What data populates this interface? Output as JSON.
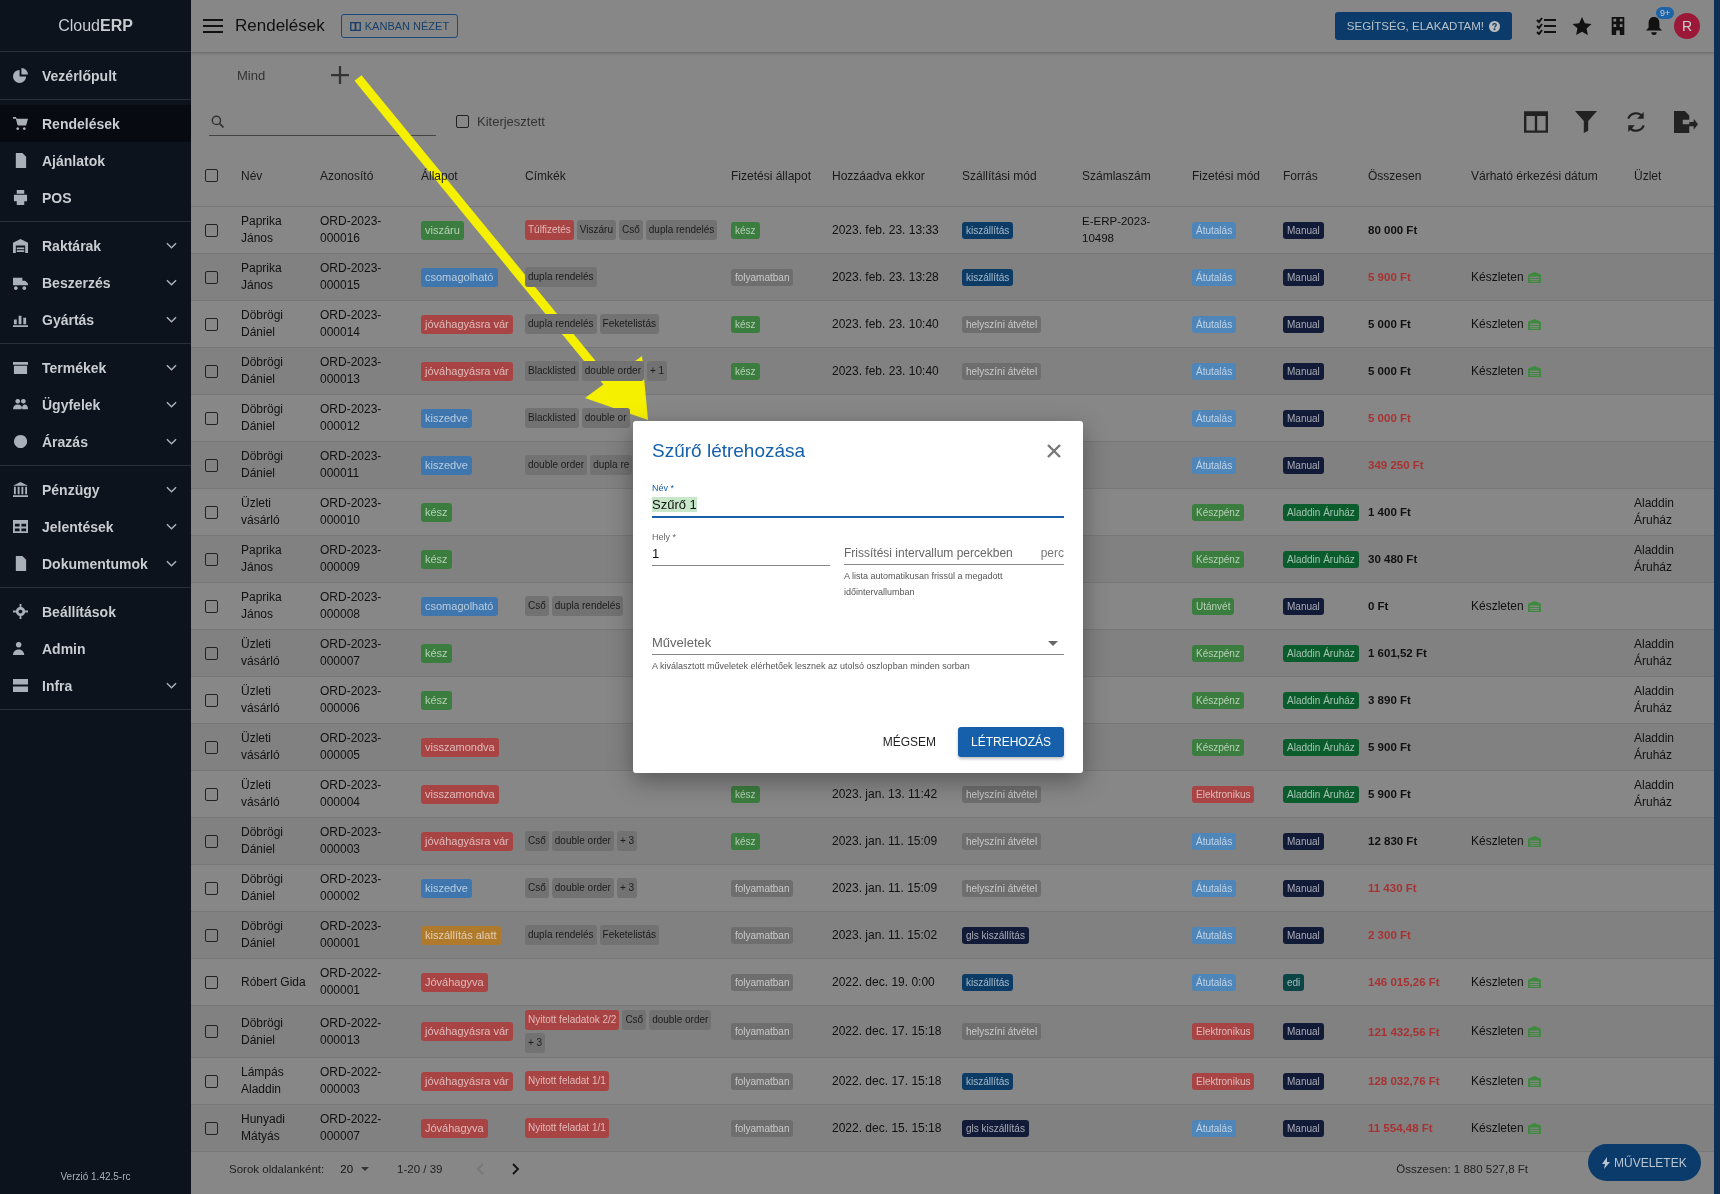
{
  "sidebar": {
    "logo_light": "Cloud",
    "logo_bold": "ERP",
    "groups": [
      {
        "items": [
          {
            "label": "Vezérlőpult",
            "kind": "link",
            "selected": false
          }
        ]
      },
      {
        "items": [
          {
            "label": "Rendelések",
            "kind": "link",
            "selected": true
          },
          {
            "label": "Ajánlatok",
            "kind": "link",
            "selected": false
          },
          {
            "label": "POS",
            "kind": "link",
            "selected": false
          }
        ]
      },
      {
        "items": [
          {
            "label": "Raktárak",
            "kind": "group",
            "selected": false
          },
          {
            "label": "Beszerzés",
            "kind": "group",
            "selected": false
          },
          {
            "label": "Gyártás",
            "kind": "group",
            "selected": false
          }
        ]
      },
      {
        "items": [
          {
            "label": "Termékek",
            "kind": "group",
            "selected": false
          },
          {
            "label": "Ügyfelek",
            "kind": "group",
            "selected": false
          },
          {
            "label": "Árazás",
            "kind": "group",
            "selected": false
          }
        ]
      },
      {
        "items": [
          {
            "label": "Pénzügy",
            "kind": "group",
            "selected": false
          },
          {
            "label": "Jelentések",
            "kind": "group",
            "selected": false
          },
          {
            "label": "Dokumentumok",
            "kind": "group",
            "selected": false
          }
        ]
      },
      {
        "items": [
          {
            "label": "Beállítások",
            "kind": "link",
            "selected": false
          },
          {
            "label": "Admin",
            "kind": "link",
            "selected": false
          },
          {
            "label": "Infra",
            "kind": "group",
            "selected": false
          }
        ]
      }
    ],
    "version": "Verzió 1.42.5-rc"
  },
  "topbar": {
    "title": "Rendelések",
    "kanban_button": "KANBAN NÉZET",
    "help_button": "SEGÍTSÉG, ELAKADTAM!",
    "notification_count": "9+",
    "avatar": "R"
  },
  "tabs": [
    {
      "label": "Mind"
    }
  ],
  "filters": {
    "extended": {
      "label": "Kiterjesztett",
      "checked": false
    }
  },
  "table": {
    "select_all_checked": false,
    "columns": [
      "Név",
      "Azonosító",
      "Állapot",
      "Címkék",
      "Fizetési állapot",
      "Hozzáadva ekkor",
      "Szállítási mód",
      "Számlaszám",
      "Fizetési mód",
      "Forrás",
      "Összesen",
      "Várható érkezési dátum",
      "Üzlet"
    ],
    "rows": [
      {
        "checked": false,
        "name": "Paprika János",
        "order_id": "ORD-2023-000016",
        "status": {
          "text": "viszáru",
          "color": "#3b7d3e"
        },
        "tags": [
          {
            "text": "Túlfizetés",
            "warning": true
          },
          {
            "text": "Viszáru",
            "warning": false
          },
          {
            "text": "Cső",
            "warning": false
          },
          {
            "text": "dupla rendelés",
            "warning": false
          }
        ],
        "payment_status": {
          "text": "kész",
          "color": "#3b7d3e"
        },
        "added": "2023. feb. 23. 13:33",
        "shipping": {
          "text": "kiszállítás",
          "color": "#0c3c66"
        },
        "invoice": "E-ERP-2023-10498",
        "payment_method": {
          "text": "Átutalás",
          "color": "#4f86ba"
        },
        "source": {
          "text": "Manual",
          "color": "#111a36"
        },
        "total": "80 000 Ft",
        "alert": false
      },
      {
        "checked": false,
        "name": "Paprika János",
        "order_id": "ORD-2023-000015",
        "status": {
          "text": "csomagolható",
          "color": "#3f76ad"
        },
        "tags": [
          {
            "text": "dupla rendelés",
            "warning": false
          }
        ],
        "payment_status": {
          "text": "folyamatban",
          "color": "#6e6e6e"
        },
        "added": "2023. feb. 23. 13:28",
        "shipping": {
          "text": "kiszállítás",
          "color": "#0c3c66"
        },
        "payment_method": {
          "text": "Átutalás",
          "color": "#4f86ba"
        },
        "source": {
          "text": "Manual",
          "color": "#111a36"
        },
        "total": "5 900 Ft",
        "alert": true,
        "expected": "Készleten"
      },
      {
        "checked": false,
        "name": "Döbrögi Dániel",
        "order_id": "ORD-2023-000014",
        "status": {
          "text": "jóváhagyásra vár",
          "color": "#a84444"
        },
        "tags": [
          {
            "text": "dupla rendelés",
            "warning": false
          },
          {
            "text": "Feketelistás",
            "warning": false
          }
        ],
        "payment_status": {
          "text": "kész",
          "color": "#3b7d3e"
        },
        "added": "2023. feb. 23. 10:40",
        "shipping": {
          "text": "helyszíni átvétel",
          "color": "#6e6e6e"
        },
        "payment_method": {
          "text": "Átutalás",
          "color": "#4f86ba"
        },
        "source": {
          "text": "Manual",
          "color": "#111a36"
        },
        "total": "5 000 Ft",
        "alert": false,
        "expected": "Készleten"
      },
      {
        "checked": false,
        "name": "Döbrögi Dániel",
        "order_id": "ORD-2023-000013",
        "status": {
          "text": "jóváhagyásra vár",
          "color": "#a84444"
        },
        "tags": [
          {
            "text": "Blacklisted",
            "warning": false
          },
          {
            "text": "double order",
            "warning": false
          },
          {
            "text": "+ 1",
            "warning": false
          }
        ],
        "payment_status": {
          "text": "kész",
          "color": "#3b7d3e"
        },
        "added": "2023. feb. 23. 10:40",
        "shipping": {
          "text": "helyszíni átvétel",
          "color": "#6e6e6e"
        },
        "payment_method": {
          "text": "Átutalás",
          "color": "#4f86ba"
        },
        "source": {
          "text": "Manual",
          "color": "#111a36"
        },
        "total": "5 000 Ft",
        "alert": false,
        "expected": "Készleten"
      },
      {
        "checked": false,
        "name": "Döbrögi Dániel",
        "order_id": "ORD-2023-000012",
        "status": {
          "text": "kiszedve",
          "color": "#3f76ad"
        },
        "tags": [
          {
            "text": "Blacklisted",
            "warning": false
          },
          {
            "text": "double or",
            "warning": false
          }
        ],
        "payment_method": {
          "text": "Átutalás",
          "color": "#4f86ba"
        },
        "source": {
          "text": "Manual",
          "color": "#111a36"
        },
        "total": "5 000 Ft",
        "alert": true
      },
      {
        "checked": false,
        "name": "Döbrögi Dániel",
        "order_id": "ORD-2023-000011",
        "status": {
          "text": "kiszedve",
          "color": "#3f76ad"
        },
        "tags": [
          {
            "text": "double order",
            "warning": false
          },
          {
            "text": "dupla re",
            "warning": false
          }
        ],
        "payment_method": {
          "text": "Átutalás",
          "color": "#4f86ba"
        },
        "source": {
          "text": "Manual",
          "color": "#111a36"
        },
        "total": "349 250 Ft",
        "alert": true
      },
      {
        "checked": false,
        "name": "Üzleti vásárló",
        "order_id": "ORD-2023-000010",
        "status": {
          "text": "kész",
          "color": "#3b7d3e"
        },
        "payment_method": {
          "text": "Készpénz",
          "color": "#3b7d3e"
        },
        "source": {
          "text": "Aladdin Áruház",
          "color": "#0b5c2c"
        },
        "total": "1 400 Ft",
        "alert": false,
        "shop": "Aladdin Áruház"
      },
      {
        "checked": false,
        "name": "Paprika János",
        "order_id": "ORD-2023-000009",
        "status": {
          "text": "kész",
          "color": "#3b7d3e"
        },
        "payment_method": {
          "text": "Készpénz",
          "color": "#3b7d3e"
        },
        "source": {
          "text": "Aladdin Áruház",
          "color": "#0b5c2c"
        },
        "total": "30 480 Ft",
        "alert": false,
        "shop": "Aladdin Áruház"
      },
      {
        "checked": false,
        "name": "Paprika János",
        "order_id": "ORD-2023-000008",
        "status": {
          "text": "csomagolható",
          "color": "#3f76ad"
        },
        "tags": [
          {
            "text": "Cső",
            "warning": false
          },
          {
            "text": "dupla rendelés",
            "warning": false
          }
        ],
        "payment_method": {
          "text": "Utánvét",
          "color": "#3b7d3e"
        },
        "source": {
          "text": "Manual",
          "color": "#111a36"
        },
        "total": "0 Ft",
        "alert": false,
        "expected": "Készleten"
      },
      {
        "checked": false,
        "name": "Üzleti vásárló",
        "order_id": "ORD-2023-000007",
        "status": {
          "text": "kész",
          "color": "#3b7d3e"
        },
        "payment_method": {
          "text": "Készpénz",
          "color": "#3b7d3e"
        },
        "source": {
          "text": "Aladdin Áruház",
          "color": "#0b5c2c"
        },
        "total": "1 601,52 Ft",
        "alert": false,
        "shop": "Aladdin Áruház"
      },
      {
        "checked": false,
        "name": "Üzleti vásárló",
        "order_id": "ORD-2023-000006",
        "status": {
          "text": "kész",
          "color": "#3b7d3e"
        },
        "payment_method": {
          "text": "Készpénz",
          "color": "#3b7d3e"
        },
        "source": {
          "text": "Aladdin Áruház",
          "color": "#0b5c2c"
        },
        "total": "3 890 Ft",
        "alert": false,
        "shop": "Aladdin Áruház"
      },
      {
        "checked": false,
        "name": "Üzleti vásárló",
        "order_id": "ORD-2023-000005",
        "status": {
          "text": "visszamondva",
          "color": "#a84444"
        },
        "payment_method": {
          "text": "Készpénz",
          "color": "#3b7d3e"
        },
        "source": {
          "text": "Aladdin Áruház",
          "color": "#0b5c2c"
        },
        "total": "5 900 Ft",
        "alert": false,
        "shop": "Aladdin Áruház"
      },
      {
        "checked": false,
        "name": "Üzleti vásárló",
        "order_id": "ORD-2023-000004",
        "status": {
          "text": "visszamondva",
          "color": "#a84444"
        },
        "payment_status": {
          "text": "kész",
          "color": "#3b7d3e"
        },
        "added": "2023. jan. 13. 11:42",
        "shipping": {
          "text": "helyszíni átvétel",
          "color": "#6e6e6e"
        },
        "payment_method": {
          "text": "Elektronikus",
          "color": "#a84444"
        },
        "source": {
          "text": "Aladdin Áruház",
          "color": "#0b5c2c"
        },
        "total": "5 900 Ft",
        "alert": false,
        "shop": "Aladdin Áruház"
      },
      {
        "checked": false,
        "name": "Döbrögi Dániel",
        "order_id": "ORD-2023-000003",
        "status": {
          "text": "jóváhagyásra vár",
          "color": "#a84444"
        },
        "tags": [
          {
            "text": "Cső",
            "warning": false
          },
          {
            "text": "double order",
            "warning": false
          },
          {
            "text": "+ 3",
            "warning": false
          }
        ],
        "payment_status": {
          "text": "kész",
          "color": "#3b7d3e"
        },
        "added": "2023. jan. 11. 15:09",
        "shipping": {
          "text": "helyszíni átvétel",
          "color": "#6e6e6e"
        },
        "payment_method": {
          "text": "Átutalás",
          "color": "#4f86ba"
        },
        "source": {
          "text": "Manual",
          "color": "#111a36"
        },
        "total": "12 830 Ft",
        "alert": false,
        "expected": "Készleten"
      },
      {
        "checked": false,
        "name": "Döbrögi Dániel",
        "order_id": "ORD-2023-000002",
        "status": {
          "text": "kiszedve",
          "color": "#3f76ad"
        },
        "tags": [
          {
            "text": "Cső",
            "warning": false
          },
          {
            "text": "double order",
            "warning": false
          },
          {
            "text": "+ 3",
            "warning": false
          }
        ],
        "payment_status": {
          "text": "folyamatban",
          "color": "#6e6e6e"
        },
        "added": "2023. jan. 11. 15:09",
        "shipping": {
          "text": "helyszíni átvétel",
          "color": "#6e6e6e"
        },
        "payment_method": {
          "text": "Átutalás",
          "color": "#4f86ba"
        },
        "source": {
          "text": "Manual",
          "color": "#111a36"
        },
        "total": "11 430 Ft",
        "alert": true
      },
      {
        "checked": false,
        "name": "Döbrögi Dániel",
        "order_id": "ORD-2023-000001",
        "status": {
          "text": "kiszállítás alatt",
          "color": "#b07a2c"
        },
        "tags": [
          {
            "text": "dupla rendelés",
            "warning": false
          },
          {
            "text": "Feketelistás",
            "warning": false
          }
        ],
        "payment_status": {
          "text": "folyamatban",
          "color": "#6e6e6e"
        },
        "added": "2023. jan. 11. 15:02",
        "shipping": {
          "text": "gls kiszállítás",
          "color": "#111a36"
        },
        "payment_method": {
          "text": "Átutalás",
          "color": "#4f86ba"
        },
        "source": {
          "text": "Manual",
          "color": "#111a36"
        },
        "total": "2 300 Ft",
        "alert": true
      },
      {
        "checked": false,
        "name": "Róbert Gida",
        "order_id": "ORD-2022-000001",
        "status": {
          "text": "Jóváhagyva",
          "color": "#a84444"
        },
        "payment_status": {
          "text": "folyamatban",
          "color": "#6e6e6e"
        },
        "added": "2022. dec. 19. 0:00",
        "shipping": {
          "text": "kiszállítás",
          "color": "#0c3c66"
        },
        "payment_method": {
          "text": "Átutalás",
          "color": "#4f86ba"
        },
        "source": {
          "text": "edi",
          "color": "#0b4545"
        },
        "total": "146 015,26 Ft",
        "alert": true,
        "expected": "Készleten"
      },
      {
        "checked": false,
        "name": "Döbrögi Dániel",
        "order_id": "ORD-2022-000013",
        "status": {
          "text": "jóváhagyásra vár",
          "color": "#a84444"
        },
        "tags": [
          {
            "text": "Nyitott feladatok 2/2",
            "warning": true
          },
          {
            "text": "Cső",
            "warning": false
          },
          {
            "text": "double order",
            "warning": false
          },
          {
            "text": "+ 3",
            "warning": false
          }
        ],
        "payment_status": {
          "text": "folyamatban",
          "color": "#6e6e6e"
        },
        "added": "2022. dec. 17. 15:18",
        "shipping": {
          "text": "helyszíni átvétel",
          "color": "#6e6e6e"
        },
        "payment_method": {
          "text": "Elektronikus",
          "color": "#a84444"
        },
        "source": {
          "text": "Manual",
          "color": "#111a36"
        },
        "total": "121 432,56 Ft",
        "alert": true,
        "expected": "Készleten"
      },
      {
        "checked": false,
        "name": "Lámpás Aladdin",
        "order_id": "ORD-2022-000003",
        "status": {
          "text": "jóváhagyásra vár",
          "color": "#a84444"
        },
        "tags": [
          {
            "text": "Nyitott feladat 1/1",
            "warning": true
          }
        ],
        "payment_status": {
          "text": "folyamatban",
          "color": "#6e6e6e"
        },
        "added": "2022. dec. 17. 15:18",
        "shipping": {
          "text": "kiszállítás",
          "color": "#0c3c66"
        },
        "payment_method": {
          "text": "Elektronikus",
          "color": "#a84444"
        },
        "source": {
          "text": "Manual",
          "color": "#111a36"
        },
        "total": "128 032,76 Ft",
        "alert": true,
        "expected": "Készleten"
      },
      {
        "checked": false,
        "name": "Hunyadi Mátyás",
        "order_id": "ORD-2022-000007",
        "status": {
          "text": "Jóváhagyva",
          "color": "#a84444"
        },
        "tags": [
          {
            "text": "Nyitott feladat 1/1",
            "warning": true
          }
        ],
        "payment_status": {
          "text": "folyamatban",
          "color": "#6e6e6e"
        },
        "added": "2022. dec. 15. 15:18",
        "shipping": {
          "text": "gls kiszállítás",
          "color": "#111a36"
        },
        "payment_method": {
          "text": "Átutalás",
          "color": "#4f86ba"
        },
        "source": {
          "text": "Manual",
          "color": "#111a36"
        },
        "total": "11 554,48 Ft",
        "alert": true,
        "expected": "Készleten"
      }
    ]
  },
  "footer": {
    "rows_per_page_label": "Sorok oldalanként:",
    "rows_per_page": "20",
    "range": "1-20 / 39",
    "prev_disabled": true,
    "next_disabled": false,
    "sum": "Összesen: 1 880 527,8 Ft"
  },
  "fab": "MŰVELETEK",
  "dialog": {
    "title": "Szűrő létrehozása",
    "name_field": {
      "label": "Név *",
      "value": "Szűrő 1",
      "focused": true
    },
    "place_field": {
      "label": "Hely *",
      "value": "1",
      "focused": false
    },
    "interval_field": {
      "placeholder": "Frissítési intervallum percekben",
      "suffix": "perc",
      "hint": "A lista automatikusan frissül a megadott időintervallumban"
    },
    "actions_select": {
      "placeholder": "Műveletek",
      "hint": "A kiválasztott műveletek elérhetőek lesznek az utolsó oszlopban minden sorban"
    },
    "cancel": "MÉGSEM",
    "confirm": "LÉTREHOZÁS"
  }
}
